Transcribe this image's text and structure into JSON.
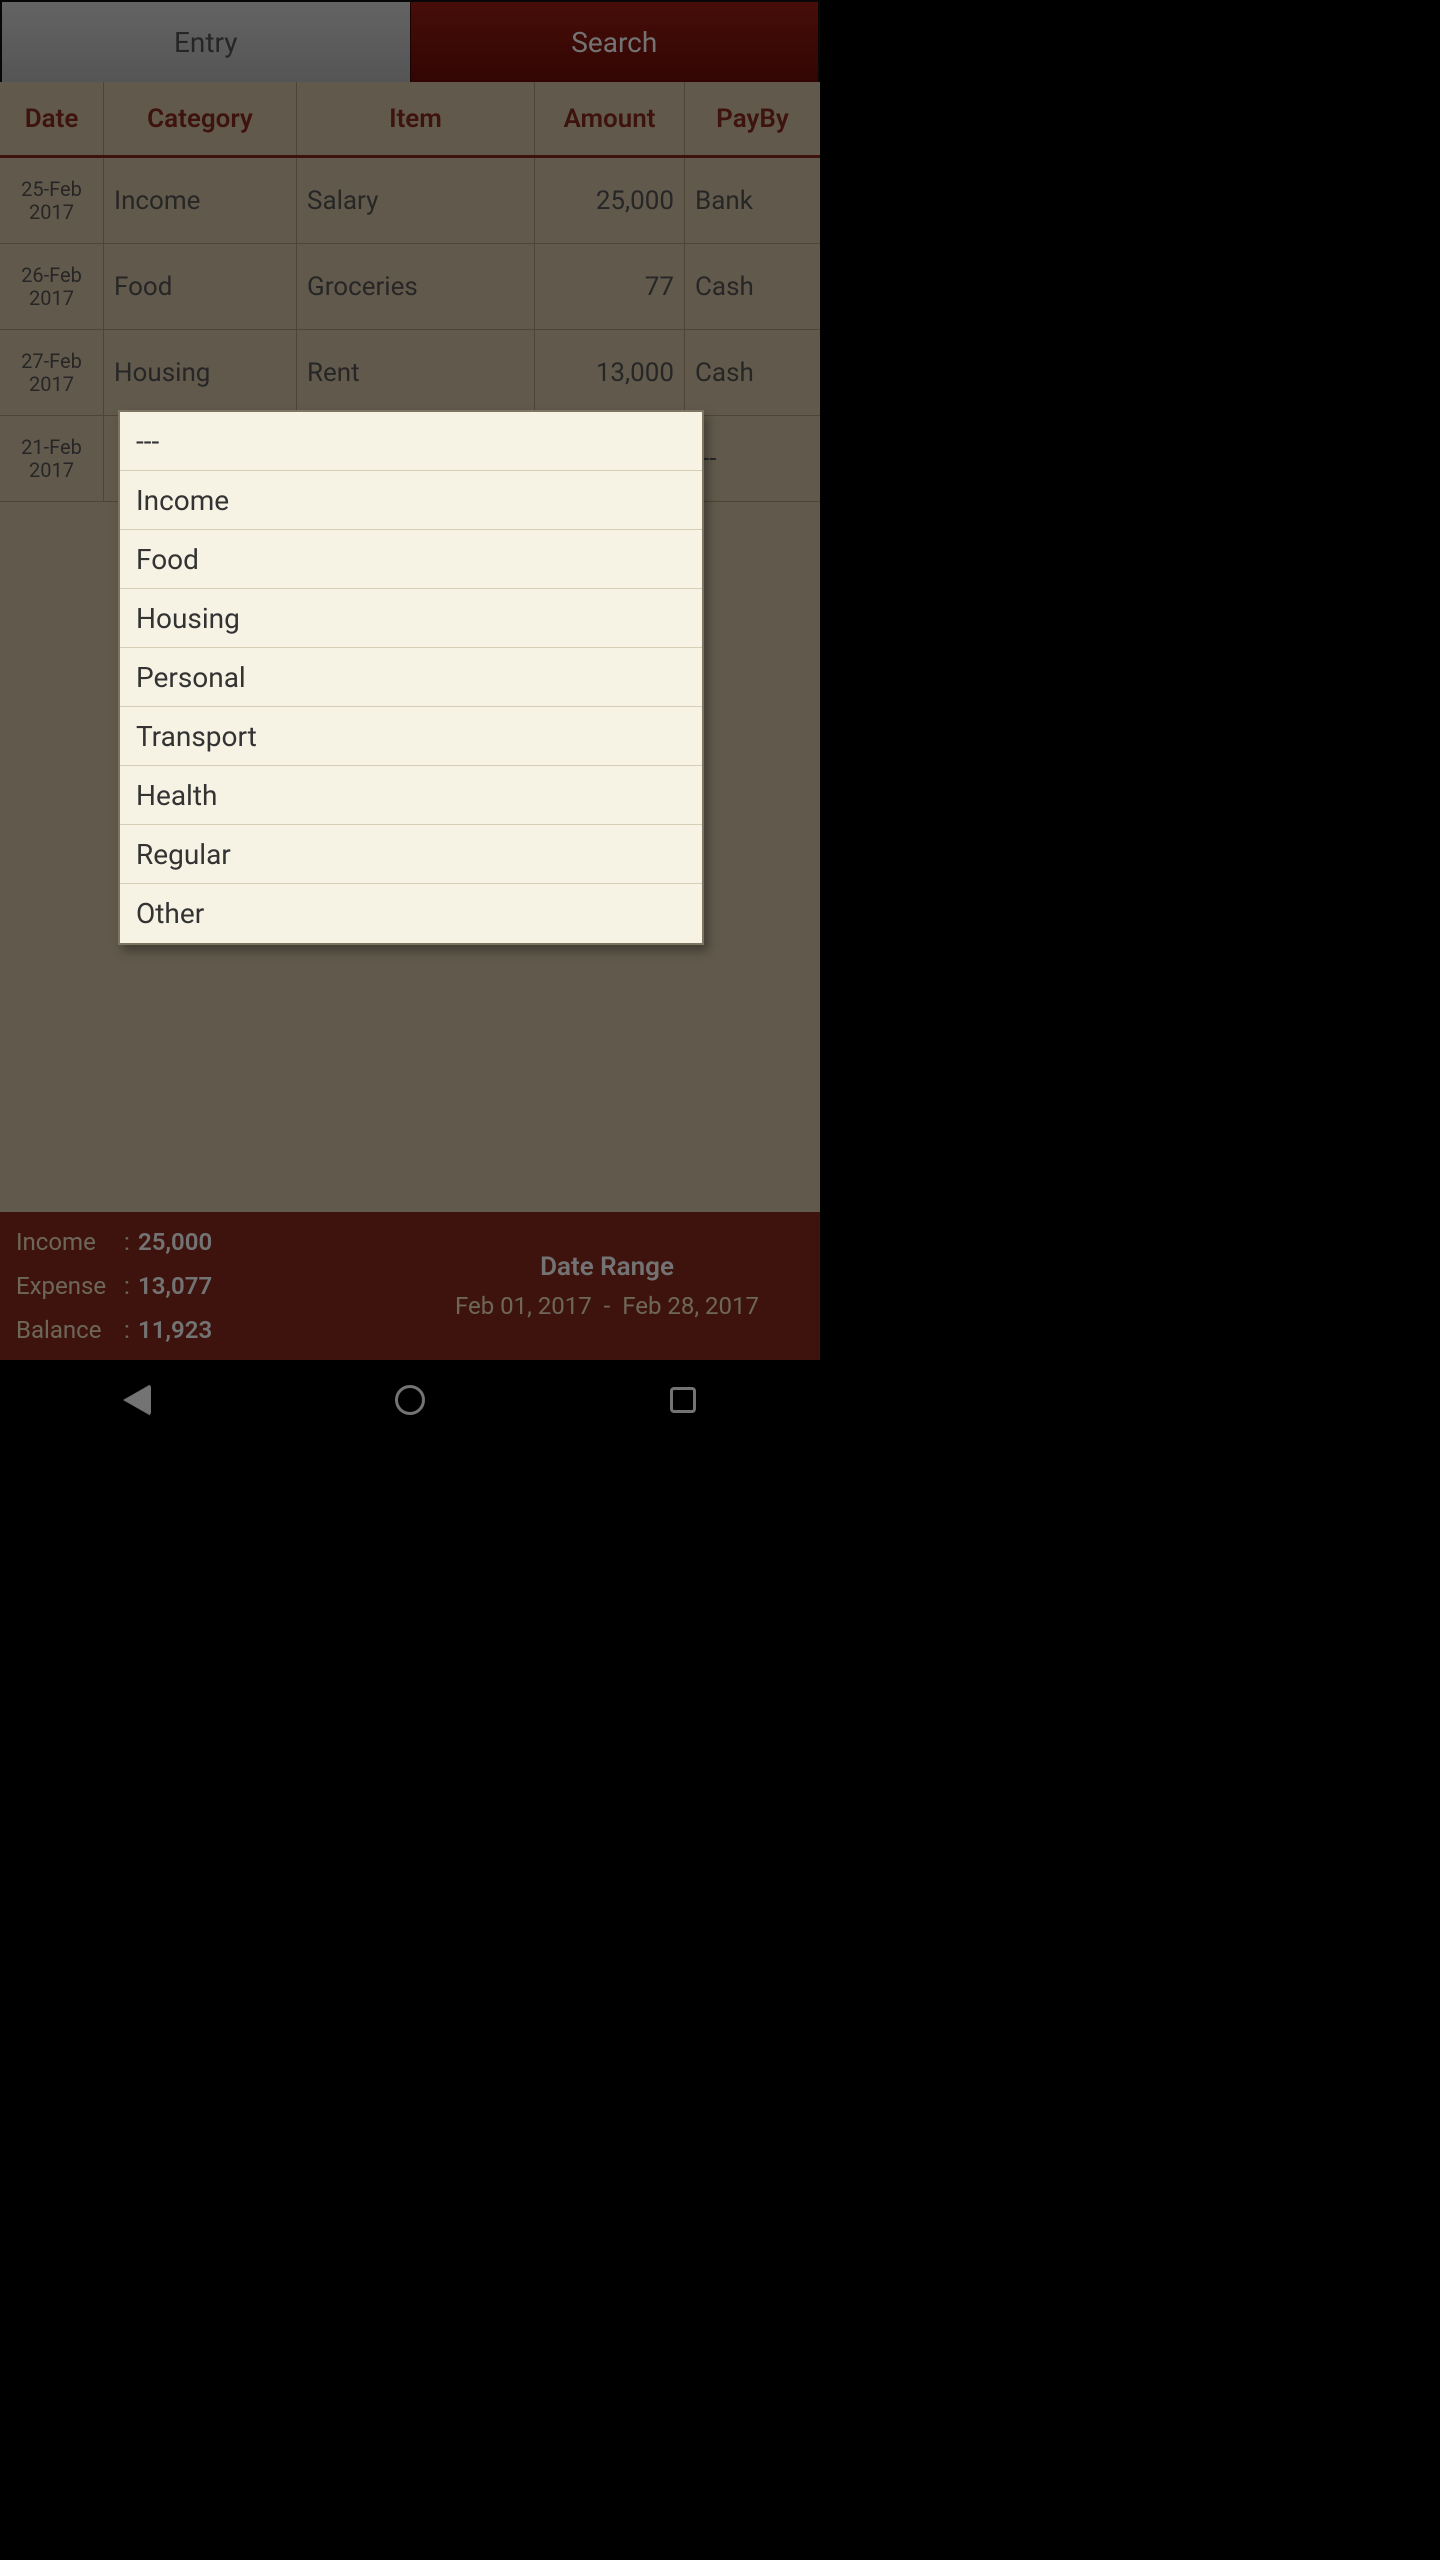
{
  "tabs": {
    "entry": "Entry",
    "search": "Search"
  },
  "columns": {
    "date": "Date",
    "category": "Category",
    "item": "Item",
    "amount": "Amount",
    "payby": "PayBy"
  },
  "rows": [
    {
      "date_l1": "25-Feb",
      "date_l2": "2017",
      "category": "Income",
      "item": "Salary",
      "amount": "25,000",
      "payby": "Bank"
    },
    {
      "date_l1": "26-Feb",
      "date_l2": "2017",
      "category": "Food",
      "item": "Groceries",
      "amount": "77",
      "payby": "Cash"
    },
    {
      "date_l1": "27-Feb",
      "date_l2": "2017",
      "category": "Housing",
      "item": "Rent",
      "amount": "13,000",
      "payby": "Cash"
    },
    {
      "date_l1": "21-Feb",
      "date_l2": "2017",
      "category": "",
      "item": "",
      "amount": "",
      "payby": "---"
    }
  ],
  "footer": {
    "income_label": "Income",
    "income_value": "25,000",
    "expense_label": "Expense",
    "expense_value": "13,077",
    "balance_label": "Balance",
    "balance_value": "11,923",
    "date_range_title": "Date Range",
    "date_from": "Feb 01, 2017",
    "date_sep": "-",
    "date_to": "Feb 28, 2017",
    "colon": ":"
  },
  "popup": {
    "items": [
      "---",
      "Income",
      "Food",
      "Housing",
      "Personal",
      "Transport",
      "Health",
      "Regular",
      "Other"
    ]
  }
}
